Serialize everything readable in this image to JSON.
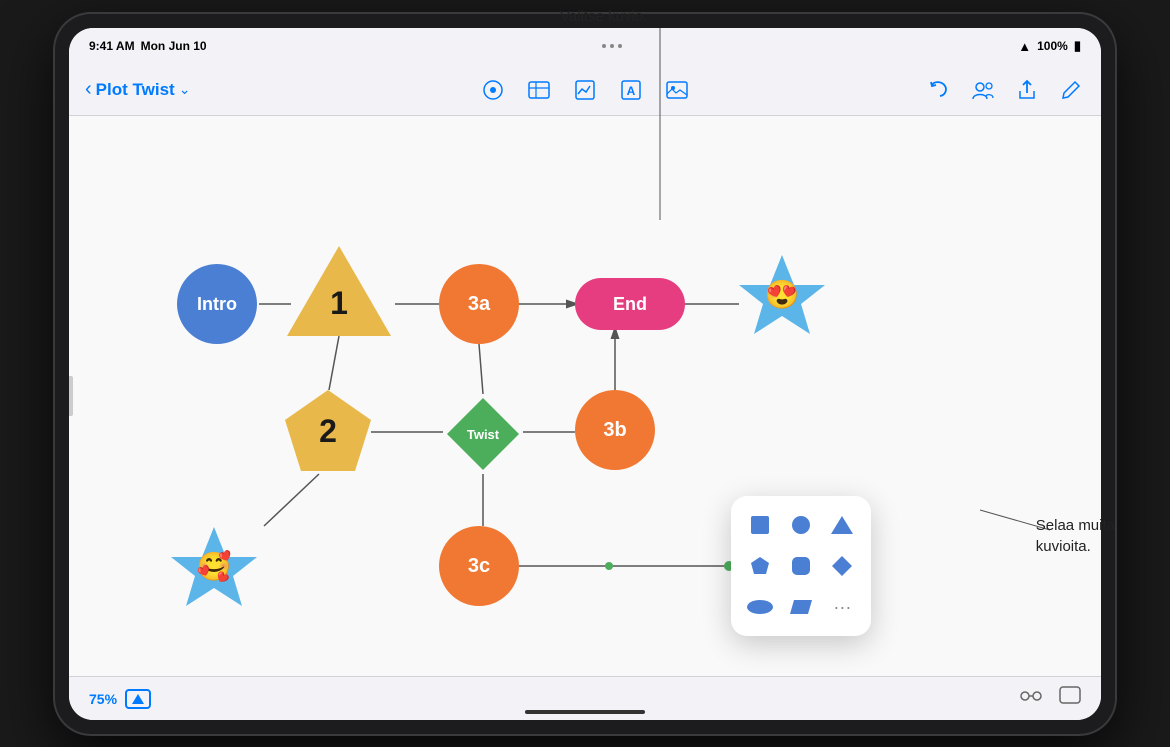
{
  "device": {
    "status_bar": {
      "time": "9:41 AM",
      "day_date": "Mon Jun 10",
      "wifi": "wifi",
      "battery": "100%"
    }
  },
  "toolbar": {
    "back_label": "Plot Twist",
    "chevron_down": "›",
    "icons": [
      "shape-icon",
      "table-icon",
      "chart-icon",
      "text-icon",
      "media-icon",
      "undo-icon",
      "collab-icon",
      "share-icon",
      "edit-icon"
    ]
  },
  "canvas": {
    "shapes": {
      "intro": "Intro",
      "triangle1": "1",
      "shape3a": "3a",
      "end": "End",
      "pentagon2": "2",
      "twist": "Twist",
      "shape3b": "3b",
      "shape3c": "3c"
    }
  },
  "shape_picker": {
    "items": [
      "square",
      "circle",
      "triangle",
      "pentagon",
      "square-grid",
      "diamond",
      "oval",
      "parallelogram",
      "more"
    ]
  },
  "bottom_bar": {
    "zoom": "75%"
  },
  "annotations": {
    "valitse_kuvio": "Valitse kuvio.",
    "selaa_muita_kuvioita_line1": "Selaa muita",
    "selaa_muita_kuvioita_line2": "kuvioita."
  }
}
